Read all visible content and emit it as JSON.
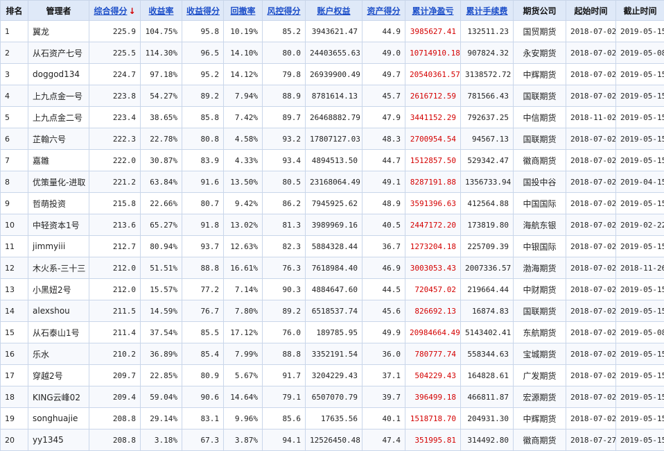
{
  "headers": [
    {
      "label": "排名",
      "sortable": false
    },
    {
      "label": "管理者",
      "sortable": false
    },
    {
      "label": "综合得分",
      "sortable": true,
      "active": true
    },
    {
      "label": "收益率",
      "sortable": true
    },
    {
      "label": "收益得分",
      "sortable": true
    },
    {
      "label": "回撤率",
      "sortable": true
    },
    {
      "label": "风控得分",
      "sortable": true
    },
    {
      "label": "账户权益",
      "sortable": true
    },
    {
      "label": "资产得分",
      "sortable": true
    },
    {
      "label": "累计净盈亏",
      "sortable": true
    },
    {
      "label": "累计手续费",
      "sortable": true
    },
    {
      "label": "期货公司",
      "sortable": false
    },
    {
      "label": "起始时间",
      "sortable": false
    },
    {
      "label": "截止时间",
      "sortable": false
    }
  ],
  "sort_arrow": "↓",
  "accent_color": "#d40000",
  "link_color": "#1d4fc9",
  "rows": [
    [
      "1",
      "翼龙",
      "225.9",
      "104.75%",
      "95.8",
      "10.19%",
      "85.2",
      "3943621.47",
      "44.9",
      "3985627.41",
      "132511.23",
      "国贸期货",
      "2018-07-02",
      "2019-05-15"
    ],
    [
      "2",
      "从石资产七号",
      "225.5",
      "114.30%",
      "96.5",
      "14.10%",
      "80.0",
      "24403655.63",
      "49.0",
      "10714910.18",
      "907824.32",
      "永安期货",
      "2018-07-02",
      "2019-05-08"
    ],
    [
      "3",
      "doggod134",
      "224.7",
      "97.18%",
      "95.2",
      "14.12%",
      "79.8",
      "26939900.49",
      "49.7",
      "20540361.57",
      "3138572.72",
      "中辉期货",
      "2018-07-02",
      "2019-05-15"
    ],
    [
      "4",
      "上九点金一号",
      "223.8",
      "54.27%",
      "89.2",
      "7.94%",
      "88.9",
      "8781614.13",
      "45.7",
      "2616712.59",
      "781566.43",
      "国联期货",
      "2018-07-02",
      "2019-05-15"
    ],
    [
      "5",
      "上九点金二号",
      "223.4",
      "38.65%",
      "85.8",
      "7.42%",
      "89.7",
      "26468882.79",
      "47.9",
      "3441152.29",
      "792637.25",
      "中信期货",
      "2018-11-02",
      "2019-05-15"
    ],
    [
      "6",
      "芷翰六号",
      "222.3",
      "22.78%",
      "80.8",
      "4.58%",
      "93.2",
      "17807127.03",
      "48.3",
      "2700954.54",
      "94567.13",
      "国联期货",
      "2018-07-02",
      "2019-05-15"
    ],
    [
      "7",
      "嘉雛",
      "222.0",
      "30.87%",
      "83.9",
      "4.33%",
      "93.4",
      "4894513.50",
      "44.7",
      "1512857.50",
      "529342.47",
      "徽商期货",
      "2018-07-02",
      "2019-05-15"
    ],
    [
      "8",
      "优策量化-进取",
      "221.2",
      "63.84%",
      "91.6",
      "13.50%",
      "80.5",
      "23168064.49",
      "49.1",
      "8287191.88",
      "1356733.94",
      "国投中谷",
      "2018-07-02",
      "2019-04-15"
    ],
    [
      "9",
      "哲萌投资",
      "215.8",
      "22.66%",
      "80.7",
      "9.42%",
      "86.2",
      "7945925.62",
      "48.9",
      "3591396.63",
      "412564.88",
      "中国国际",
      "2018-07-02",
      "2019-05-15"
    ],
    [
      "10",
      "中轻资本1号",
      "213.6",
      "65.27%",
      "91.8",
      "13.02%",
      "81.3",
      "3989969.16",
      "40.5",
      "2447172.20",
      "173819.80",
      "海航东银",
      "2018-07-02",
      "2019-02-22"
    ],
    [
      "11",
      "jimmyiii",
      "212.7",
      "80.94%",
      "93.7",
      "12.63%",
      "82.3",
      "5884328.44",
      "36.7",
      "1273204.18",
      "225709.39",
      "中银国际",
      "2018-07-02",
      "2019-05-15"
    ],
    [
      "12",
      "木火系-三十三",
      "212.0",
      "51.51%",
      "88.8",
      "16.61%",
      "76.3",
      "7618984.40",
      "46.9",
      "3003053.43",
      "2007336.57",
      "渤海期货",
      "2018-07-02",
      "2018-11-26"
    ],
    [
      "13",
      "小黑妞2号",
      "212.0",
      "15.57%",
      "77.2",
      "7.14%",
      "90.3",
      "4884647.60",
      "44.5",
      "720457.02",
      "219664.44",
      "中财期货",
      "2018-07-02",
      "2019-05-15"
    ],
    [
      "14",
      "alexshou",
      "211.5",
      "14.59%",
      "76.7",
      "7.80%",
      "89.2",
      "6518537.74",
      "45.6",
      "826692.13",
      "16874.83",
      "国联期货",
      "2018-07-02",
      "2019-05-15"
    ],
    [
      "15",
      "从石泰山1号",
      "211.4",
      "37.54%",
      "85.5",
      "17.12%",
      "76.0",
      "189785.95",
      "49.9",
      "20984664.49",
      "5143402.41",
      "东航期货",
      "2018-07-02",
      "2019-05-08"
    ],
    [
      "16",
      "乐水",
      "210.2",
      "36.89%",
      "85.4",
      "7.99%",
      "88.8",
      "3352191.54",
      "36.0",
      "780777.74",
      "558344.63",
      "宝城期货",
      "2018-07-02",
      "2019-05-15"
    ],
    [
      "17",
      "穿越2号",
      "209.7",
      "22.85%",
      "80.9",
      "5.67%",
      "91.7",
      "3204229.43",
      "37.1",
      "504229.43",
      "164828.61",
      "广发期货",
      "2018-07-02",
      "2019-05-15"
    ],
    [
      "18",
      "KING云峰02",
      "209.4",
      "59.04%",
      "90.6",
      "14.64%",
      "79.1",
      "6507070.79",
      "39.7",
      "396499.18",
      "466811.87",
      "宏源期货",
      "2018-07-02",
      "2019-05-15"
    ],
    [
      "19",
      "songhuajie",
      "208.8",
      "29.14%",
      "83.1",
      "9.96%",
      "85.6",
      "17635.56",
      "40.1",
      "1518718.70",
      "204931.30",
      "中辉期货",
      "2018-07-02",
      "2019-05-15"
    ],
    [
      "20",
      "yy1345",
      "208.8",
      "3.18%",
      "67.3",
      "3.87%",
      "94.1",
      "12526450.48",
      "47.4",
      "351995.81",
      "314492.80",
      "徽商期货",
      "2018-07-27",
      "2019-05-15"
    ]
  ]
}
